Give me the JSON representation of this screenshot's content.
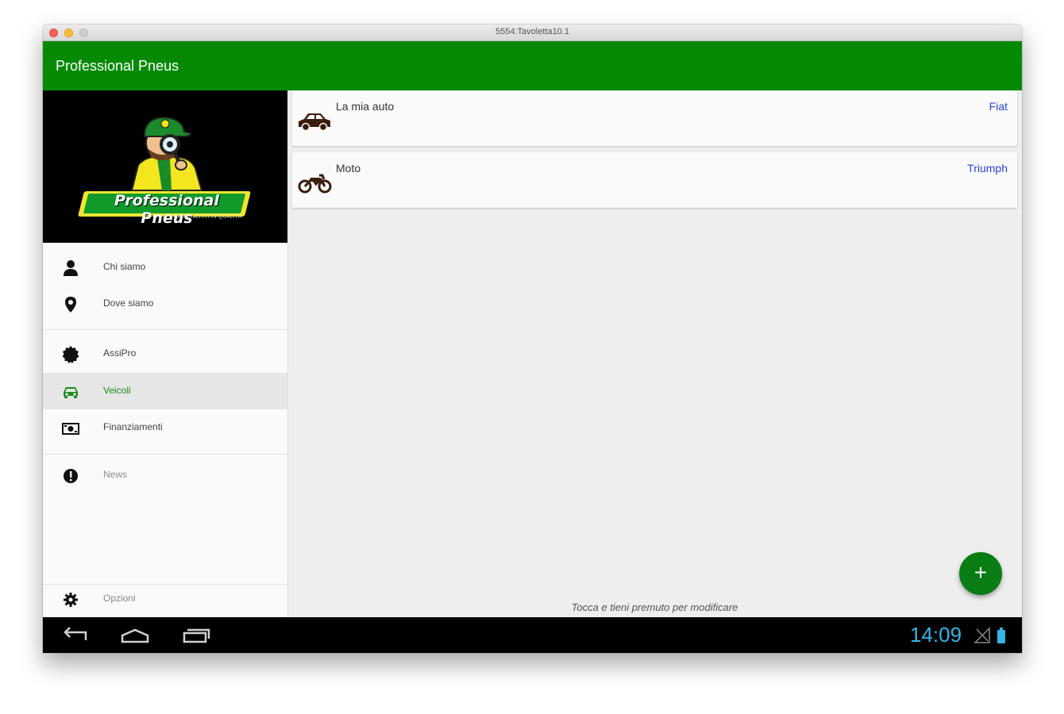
{
  "window": {
    "title": "5554:Tavoletta10.1"
  },
  "appbar": {
    "title": "Professional Pneus"
  },
  "drawer": {
    "logo": {
      "brand": "Professional Pneus",
      "tagline": "SPECIALISTI IN QUALITÀ"
    },
    "items": [
      {
        "label": "Chi siamo",
        "icon": "person-icon"
      },
      {
        "label": "Dove siamo",
        "icon": "location-pin-icon"
      },
      {
        "label": "AssiPro",
        "icon": "badge-icon"
      },
      {
        "label": "Veicoli",
        "icon": "car-icon",
        "active": true
      },
      {
        "label": "Finanziamenti",
        "icon": "money-icon"
      },
      {
        "label": "News",
        "icon": "alert-icon"
      },
      {
        "label": "Opzioni",
        "icon": "gear-icon"
      }
    ]
  },
  "vehicles": [
    {
      "name": "La mia auto",
      "brand": "Fiat",
      "icon": "car-icon"
    },
    {
      "name": "Moto",
      "brand": "Triumph",
      "icon": "motorcycle-icon"
    }
  ],
  "hint": "Tocca e tieni premuto per modificare",
  "fab": {
    "label": "+"
  },
  "statusbar": {
    "time": "14:09"
  },
  "colors": {
    "primary": "#068a06",
    "accent": "#0a7c14",
    "brand_link": "#2b44d6",
    "clock": "#33b5e5"
  }
}
